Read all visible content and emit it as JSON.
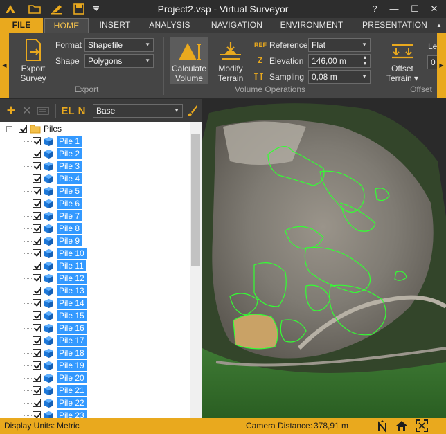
{
  "app": {
    "title": "Project2.vsp  -  Virtual Surveyor",
    "help": "?",
    "minimize": "—",
    "maximize": "☐",
    "close": "✕"
  },
  "tabs": [
    {
      "label": "FILE"
    },
    {
      "label": "HOME"
    },
    {
      "label": "INSERT"
    },
    {
      "label": "ANALYSIS"
    },
    {
      "label": "NAVIGATION"
    },
    {
      "label": "ENVIRONMENT"
    },
    {
      "label": "PRESENTATION"
    }
  ],
  "ribbon": {
    "export_survey": "Export\nSurvey",
    "format_label": "Format",
    "format_value": "Shapefile",
    "shape_label": "Shape",
    "shape_value": "Polygons",
    "export_group": "Export",
    "calculate_volume": "Calculate\nVolume",
    "modify_terrain": "Modify\nTerrain",
    "reference_icon": "REF",
    "reference_label": "Reference",
    "reference_value": "Flat",
    "elevation_icon": "Z",
    "elevation_label": "Elevation",
    "elevation_value": "146,00 m",
    "sampling_label": "Sampling",
    "sampling_value": "0,08 m",
    "volume_group": "Volume Operations",
    "offset_terrain": "Offset\nTerrain ▾",
    "offset_group": "Offset",
    "cutoff_label": "Le",
    "cutoff_value": "0"
  },
  "toolbar": {
    "add": "+",
    "delete": "✕",
    "el": "EL",
    "n": "N",
    "layer_value": "Base"
  },
  "tree": {
    "root_label": "Piles",
    "items": [
      "Pile 1",
      "Pile 2",
      "Pile 3",
      "Pile  4",
      "Pile 5",
      "Pile 6",
      "Pile 7",
      "Pile 8",
      "Pile 9",
      "Pile 10",
      "Pile 11",
      "Pile 12",
      "Pile 13",
      "Pile 14",
      "Pile 15",
      "Pile 16",
      "Pile 17",
      "Pile 18",
      "Pile 19",
      "Pile 20",
      "Pile 21",
      "Pile 22",
      "Pile 23"
    ]
  },
  "status": {
    "units_label": "Display Units:",
    "units_value": "Metric",
    "camera_label": "Camera Distance:",
    "camera_value": "378,91 m"
  },
  "colors": {
    "accent": "#e9a91e",
    "selection": "#3399ff",
    "outline": "#33ff33"
  }
}
